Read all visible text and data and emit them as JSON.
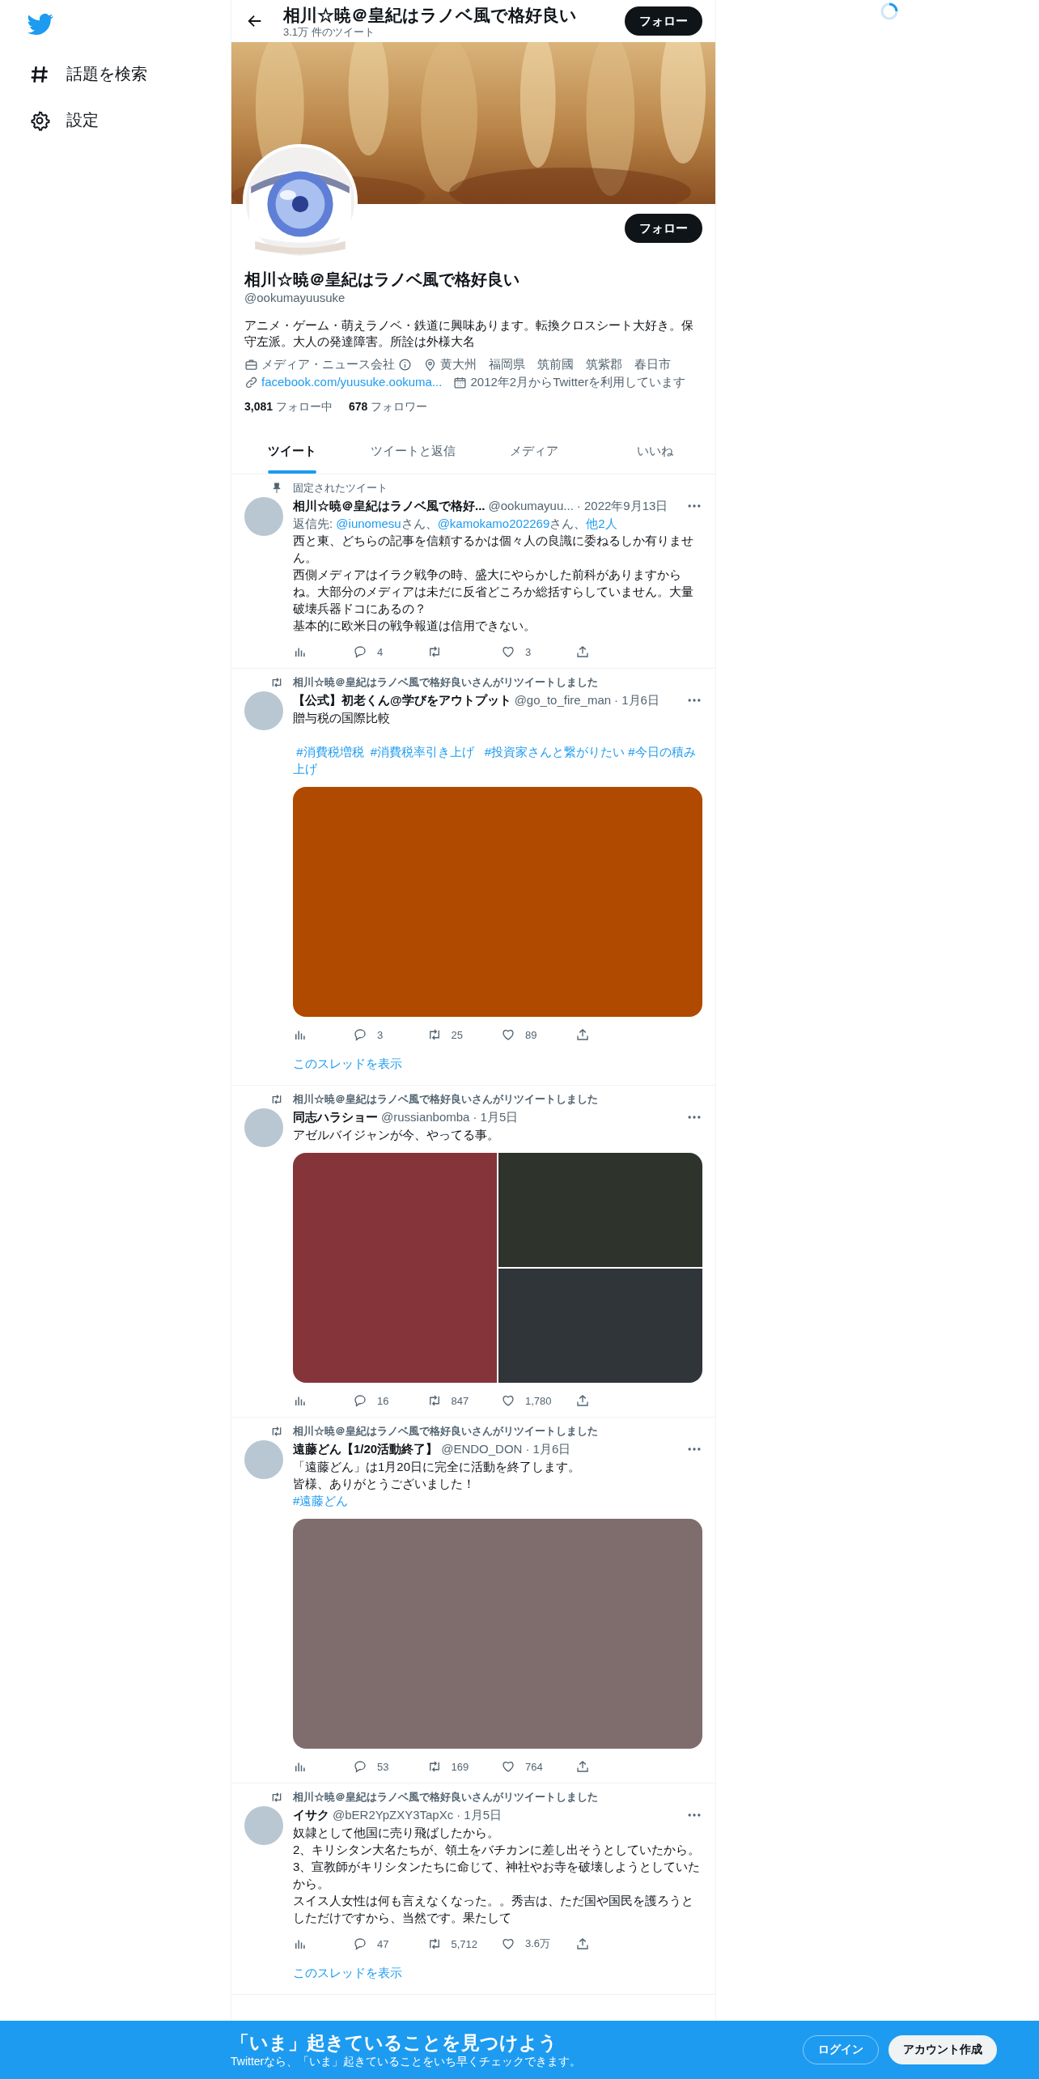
{
  "sidebar": {
    "items": [
      {
        "kind": "hash",
        "label": "話題を検索"
      },
      {
        "kind": "gear",
        "label": "設定"
      }
    ]
  },
  "header": {
    "title": "相川☆暁＠皇紀はラノベ風で格好良い",
    "subtitle": "3.1万 件のツイート",
    "follow": "フォロー"
  },
  "profile": {
    "follow": "フォロー",
    "name": "相川☆暁＠皇紀はラノベ風で格好良い",
    "handle": "@ookumayuusuke",
    "bio": "アニメ・ゲーム・萌えラノベ・鉄道に興味あります。転換クロスシート大好き。保守左派。大人の発達障害。所詮は外様大名",
    "meta": [
      {
        "kind": "work",
        "text": "メディア・ニュース会社"
      },
      {
        "kind": "location",
        "text": "黄大州　福岡県　筑前國　筑紫郡　春日市"
      },
      {
        "kind": "link",
        "text": "facebook.com/yuusuke.ookuma..."
      },
      {
        "kind": "joined",
        "text": "2012年2月からTwitterを利用しています"
      }
    ],
    "stats": [
      {
        "count": "3,081",
        "label": "フォロー中"
      },
      {
        "count": "678",
        "label": "フォロワー"
      }
    ]
  },
  "tabs": [
    {
      "label": "ツイート",
      "selected": true
    },
    {
      "label": "ツイートと返信",
      "selected": false
    },
    {
      "label": "メディア",
      "selected": false
    },
    {
      "label": "いいね",
      "selected": false
    }
  ],
  "tweets": [
    {
      "context": {
        "kind": "pinned",
        "text": "固定されたツイート"
      },
      "name": "相川☆暁＠皇紀はラノベ風で格好...",
      "handle": "@ookumayuu...",
      "date": "· 2022年9月13日",
      "reply_to": [
        {
          "text": "返信先: ",
          "link": false
        },
        {
          "text": "@iunomesu",
          "link": true
        },
        {
          "text": "さん、",
          "link": false
        },
        {
          "text": "@kamokamo202269",
          "link": true
        },
        {
          "text": "さん、",
          "link": false
        },
        {
          "text": "他2人",
          "link": true
        }
      ],
      "body": [
        "西と東、どちらの記事を信頼するかは個々人の良識に委ねるしか有りません。",
        "西側メディアはイラク戦争の時、盛大にやらかした前科がありますからね。大部分のメディアは未だに反省どころか総括すらしていません。大量破壊兵器ドコにあるの？",
        "基本的に欧米日の戦争報道は信用できない。"
      ],
      "actions": {
        "replies": "4",
        "likes": "3"
      }
    },
    {
      "context": {
        "kind": "retweet",
        "text": "相川☆暁＠皇紀はラノベ風で格好良いさんがリツイートしました"
      },
      "name": "【公式】初老くん@学びをアウトプット",
      "handle": "@go_to_fire_man",
      "date": "· 1月6日",
      "body": [
        "贈与税の国際比較"
      ],
      "hashtags": " #消費税増税  #消費税率引き上げ   #投資家さんと繋がりたい #今日の積み上げ",
      "hashtags_gap": true,
      "media": {
        "items": [
          {
            "color": "#b04a00"
          }
        ]
      },
      "actions": {
        "replies": "3",
        "retweets": "25",
        "likes": "89"
      },
      "show_thread": "このスレッドを表示"
    },
    {
      "context": {
        "kind": "retweet",
        "text": "相川☆暁＠皇紀はラノベ風で格好良いさんがリツイートしました"
      },
      "name": "同志ハラショー",
      "handle": "@russianbomba",
      "date": "· 1月5日",
      "body": [
        "アゼルバイジャンが今、やってる事。"
      ],
      "media": {
        "items": [
          {
            "color": "#85353a"
          },
          {
            "color": "#2e332b"
          },
          {
            "color": "#30353a"
          }
        ]
      },
      "actions": {
        "replies": "16",
        "retweets": "847",
        "likes": "1,780"
      }
    },
    {
      "context": {
        "kind": "retweet",
        "text": "相川☆暁＠皇紀はラノベ風で格好良いさんがリツイートしました"
      },
      "name": "遠藤どん【1/20活動終了】",
      "handle": "@ENDO_DON",
      "date": "· 1月6日",
      "body": [
        "「遠藤どん」は1月20日に完全に活動を終了します。",
        "皆様、ありがとうございました！"
      ],
      "hashtags": "#遠藤どん",
      "hashtags_gap": false,
      "media": {
        "items": [
          {
            "color": "#7f6d6e"
          }
        ]
      },
      "actions": {
        "replies": "53",
        "retweets": "169",
        "likes": "764"
      }
    },
    {
      "context": {
        "kind": "retweet",
        "text": "相川☆暁＠皇紀はラノベ風で格好良いさんがリツイートしました"
      },
      "name": "イサク",
      "handle": "@bER2YpZXY3TapXc",
      "date": "· 1月5日",
      "body": [
        "奴隷として他国に売り飛ばしたから。",
        "2、キリシタン大名たちが、領土をバチカンに差し出そうとしていたから。",
        "3、宣教師がキリシタンたちに命じて、神社やお寺を破壊しようとしていたから。",
        "スイス人女性は何も言えなくなった。。秀吉は、ただ国や国民を護ろうとしただけですから、当然です。果たして"
      ],
      "actions": {
        "replies": "47",
        "retweets": "5,712",
        "likes": "3.6万"
      },
      "show_thread": "このスレッドを表示"
    }
  ],
  "banner": {
    "title": "「いま」起きていることを見つけよう",
    "subtitle": "Twitterなら、「いま」起きていることをいち早くチェックできます。",
    "login": "ログイン",
    "signup": "アカウント作成"
  }
}
